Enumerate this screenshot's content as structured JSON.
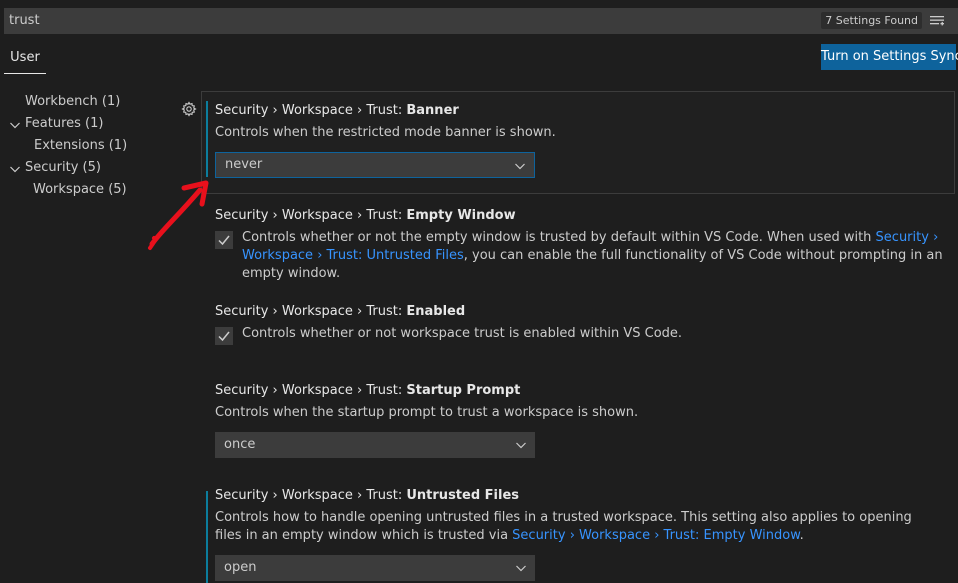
{
  "search": {
    "value": "trust",
    "results_count": "7 Settings Found",
    "filter_icon": "filter-list-icon"
  },
  "tabs": [
    {
      "label": "User"
    }
  ],
  "sync_button": {
    "label": "Turn on Settings Sync"
  },
  "toc": [
    {
      "label": "Workbench (1)",
      "expanded": false
    },
    {
      "label": "Features (1)",
      "expanded": true
    },
    {
      "label": "Extensions (1)",
      "child": true
    },
    {
      "label": "Security (5)",
      "expanded": true
    },
    {
      "label": "Workspace (5)",
      "child": true
    }
  ],
  "settings": {
    "banner": {
      "prefix": "Security › Workspace › Trust: ",
      "name": "Banner",
      "description": "Controls when the restricted mode banner is shown.",
      "value": "never"
    },
    "empty_window": {
      "prefix": "Security › Workspace › Trust: ",
      "name": "Empty Window",
      "desc_part1": "Controls whether or not the empty window is trusted by default within VS Code. When used with ",
      "desc_link": "Security › Workspace › Trust: Untrusted Files",
      "desc_part2": ", you can enable the full functionality of VS Code without prompting in an empty window.",
      "checked": true
    },
    "enabled": {
      "prefix": "Security › Workspace › Trust: ",
      "name": "Enabled",
      "description": "Controls whether or not workspace trust is enabled within VS Code.",
      "checked": true
    },
    "startup_prompt": {
      "prefix": "Security › Workspace › Trust: ",
      "name": "Startup Prompt",
      "description": "Controls when the startup prompt to trust a workspace is shown.",
      "value": "once"
    },
    "untrusted_files": {
      "prefix": "Security › Workspace › Trust: ",
      "name": "Untrusted Files",
      "desc_part1": "Controls how to handle opening untrusted files in a trusted workspace. This setting also applies to opening files in an empty window which is trusted via ",
      "desc_link": "Security › Workspace › Trust: Empty Window",
      "desc_part2": ".",
      "value": "open"
    }
  },
  "colors": {
    "accent": "#0e639c",
    "link": "#3794ff",
    "modified_indicator": "#0c7d9d",
    "annotation_arrow": "#e8101c"
  }
}
